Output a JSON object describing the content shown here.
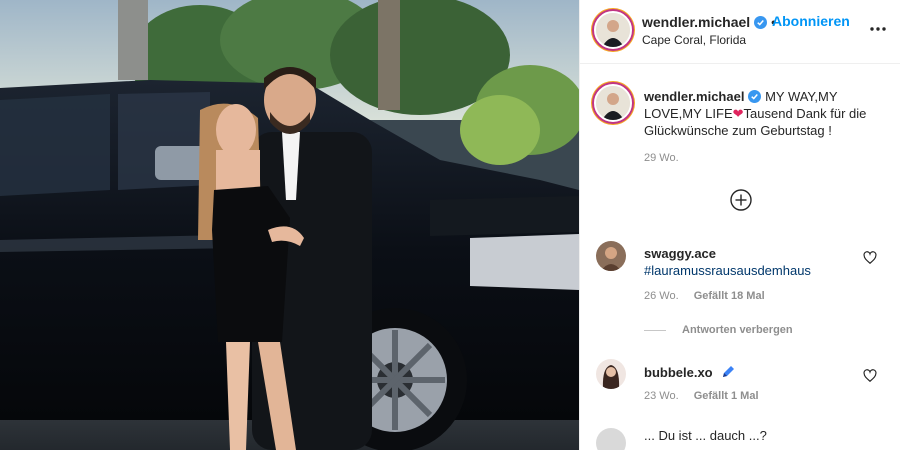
{
  "header": {
    "username": "wendler.michael",
    "separator": "•",
    "follow_label": "Abonnieren",
    "location": "Cape Coral, Florida",
    "avatar_icon": "profile-photo",
    "more_icon": "more-options-icon"
  },
  "caption": {
    "username": "wendler.michael",
    "text": "MY WAY,MY LOVE,MY LIFE",
    "emoji": "❤",
    "text_rest": "Tausend Dank für die Glückwünsche zum Geburtstag !",
    "time": "29 Wo."
  },
  "load_more_icon": "plus-circle-icon",
  "comments": [
    {
      "username": "swaggy.ace",
      "text": "#lauramussrausausdemhaus",
      "time": "26 Wo.",
      "likes": "Gefällt 18 Mal"
    },
    {
      "username": "bubbele.xo",
      "badge": "pen-emoji",
      "time": "23 Wo.",
      "likes": "Gefällt 1 Mal"
    }
  ],
  "replies_toggle": "Antworten verbergen",
  "partial_comment": "... Du ist ... dauch ...?",
  "colors": {
    "accent": "#0095f6",
    "hashtag": "#00376b",
    "muted": "#8e8e8e",
    "verified": "#3897f0",
    "heart_emoji": "#e0245e"
  }
}
